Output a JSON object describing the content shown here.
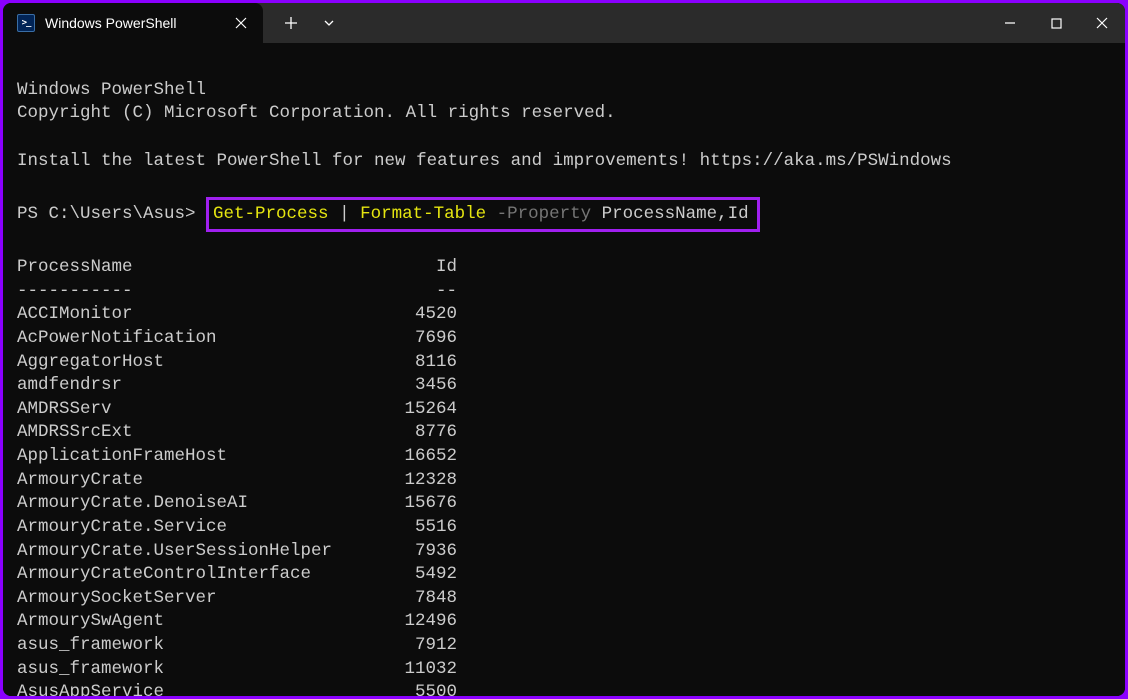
{
  "tab": {
    "title": "Windows PowerShell"
  },
  "banner": {
    "line1": "Windows PowerShell",
    "line2": "Copyright (C) Microsoft Corporation. All rights reserved.",
    "line3": "Install the latest PowerShell for new features and improvements! https://aka.ms/PSWindows"
  },
  "prompt": {
    "prefix": "PS C:\\Users\\Asus> ",
    "cmd1": "Get-Process",
    "pipe": " | ",
    "cmd2": "Format-Table",
    "param": " -Property ",
    "args": "ProcessName,Id"
  },
  "table": {
    "header_name": "ProcessName",
    "header_id": "Id",
    "sep_name": "-----------",
    "sep_id": "--",
    "rows": [
      {
        "name": "ACCIMonitor",
        "id": "4520"
      },
      {
        "name": "AcPowerNotification",
        "id": "7696"
      },
      {
        "name": "AggregatorHost",
        "id": "8116"
      },
      {
        "name": "amdfendrsr",
        "id": "3456"
      },
      {
        "name": "AMDRSServ",
        "id": "15264"
      },
      {
        "name": "AMDRSSrcExt",
        "id": "8776"
      },
      {
        "name": "ApplicationFrameHost",
        "id": "16652"
      },
      {
        "name": "ArmouryCrate",
        "id": "12328"
      },
      {
        "name": "ArmouryCrate.DenoiseAI",
        "id": "15676"
      },
      {
        "name": "ArmouryCrate.Service",
        "id": "5516"
      },
      {
        "name": "ArmouryCrate.UserSessionHelper",
        "id": "7936"
      },
      {
        "name": "ArmouryCrateControlInterface",
        "id": "5492"
      },
      {
        "name": "ArmourySocketServer",
        "id": "7848"
      },
      {
        "name": "ArmourySwAgent",
        "id": "12496"
      },
      {
        "name": "asus_framework",
        "id": "7912"
      },
      {
        "name": "asus_framework",
        "id": "11032"
      },
      {
        "name": "AsusAppService",
        "id": "5500"
      }
    ]
  }
}
